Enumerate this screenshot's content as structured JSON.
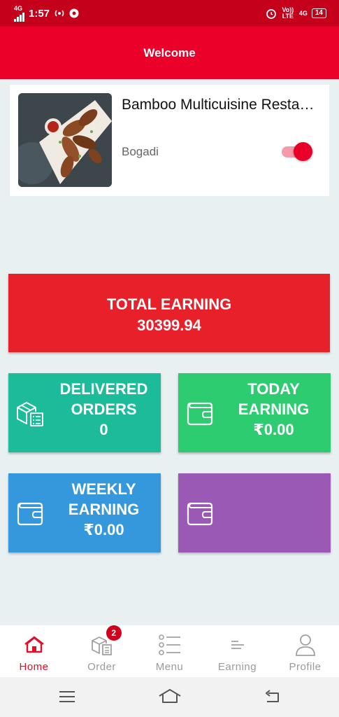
{
  "status_bar": {
    "network": "4G",
    "time": "1:57",
    "volte": "Vo)) LTE",
    "network_right": "4G",
    "battery": "14"
  },
  "header": {
    "title": "Welcome"
  },
  "restaurant": {
    "name": "Bamboo Multicuisine Restaurant",
    "location": "Bogadi",
    "online": true
  },
  "stats": {
    "total": {
      "label": "TOTAL EARNING",
      "value": "30399.94"
    },
    "delivered": {
      "label_line1": "DELIVERED",
      "label_line2": "ORDERS",
      "value": "0"
    },
    "today": {
      "label_line1": "TODAY",
      "label_line2": "EARNING",
      "value": "₹0.00"
    },
    "weekly": {
      "label_line1": "WEEKLY",
      "label_line2": "EARNING",
      "value": "₹0.00"
    }
  },
  "bottom_nav": {
    "items": [
      {
        "label": "Home",
        "icon": "home-icon",
        "active": true
      },
      {
        "label": "Order",
        "icon": "order-box-icon",
        "badge": "2"
      },
      {
        "label": "Menu",
        "icon": "menu-list-icon"
      },
      {
        "label": "Earning",
        "icon": "earning-lines-icon"
      },
      {
        "label": "Profile",
        "icon": "profile-icon"
      }
    ]
  },
  "colors": {
    "status_bar": "#c5001a",
    "header": "#ea0029",
    "total_tile": "#e8202a",
    "delivered_tile": "#1cbc9b",
    "today_tile": "#2ecc71",
    "weekly_tile": "#3598dc",
    "purple_tile": "#9b59b6",
    "accent": "#e0102a"
  }
}
